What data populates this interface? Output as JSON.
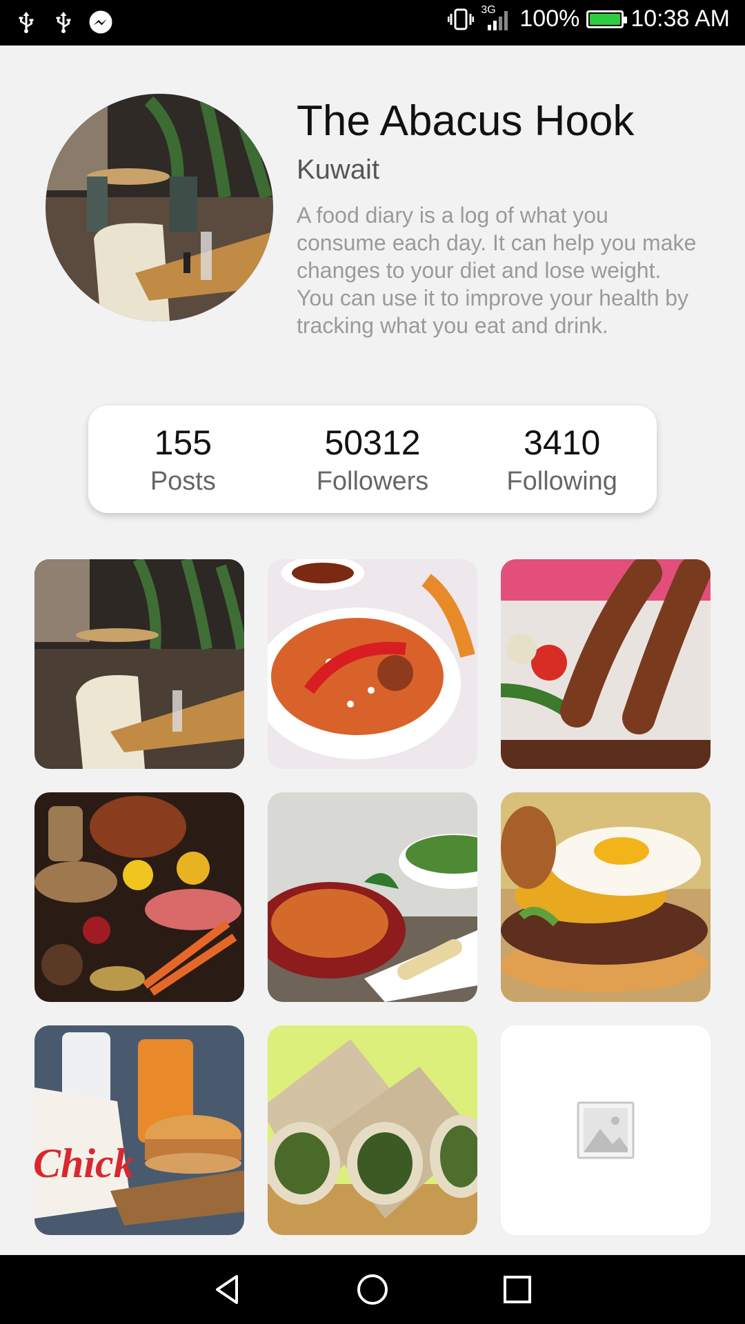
{
  "status_bar": {
    "left_icons": [
      "usb-icon",
      "usb-icon",
      "messenger-icon"
    ],
    "network": "3G",
    "battery_percent": "100%",
    "time": "10:38 AM"
  },
  "profile": {
    "name": "The Abacus Hook",
    "location": "Kuwait",
    "description": "A food diary is a log of what you consume each day. It can help you make changes to your diet and lose weight. You can use it to improve your health by tracking what you eat and drink."
  },
  "stats": [
    {
      "value": "155",
      "label": "Posts"
    },
    {
      "value": "50312",
      "label": "Followers"
    },
    {
      "value": "3410",
      "label": "Following"
    }
  ],
  "grid": {
    "items": [
      {
        "name": "restaurant-interior-photo"
      },
      {
        "name": "biryani-photo"
      },
      {
        "name": "kebab-photo"
      },
      {
        "name": "groceries-photo"
      },
      {
        "name": "pasta-salad-photo"
      },
      {
        "name": "burger-egg-photo"
      },
      {
        "name": "chicken-sandwich-photo"
      },
      {
        "name": "wraps-photo"
      },
      {
        "name": "image-placeholder"
      }
    ]
  },
  "nav": [
    "back-icon",
    "home-icon",
    "recents-icon"
  ],
  "colors": {
    "background": "#f2f2f3",
    "battery_fill": "#2ecc40"
  }
}
